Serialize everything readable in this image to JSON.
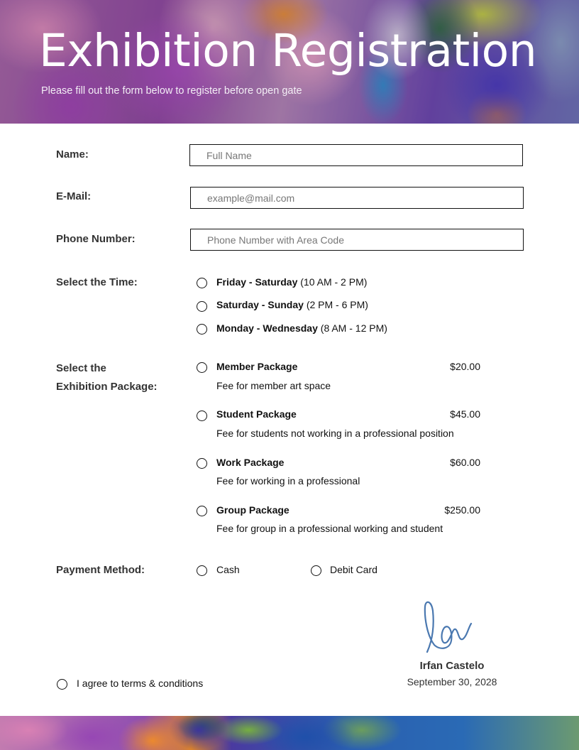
{
  "header": {
    "title": "Exhibition Registration",
    "subtitle": "Please fill out the form below to register before open gate"
  },
  "fields": {
    "name": {
      "label": "Name:",
      "placeholder": "Full Name",
      "value": ""
    },
    "email": {
      "label": "E-Mail:",
      "placeholder": "example@mail.com",
      "value": ""
    },
    "phone": {
      "label": "Phone Number:",
      "placeholder": "Phone Number with Area Code",
      "value": ""
    }
  },
  "time": {
    "label": "Select the Time:",
    "options": [
      {
        "days": "Friday - Saturday",
        "hours": "(10 AM - 2 PM)",
        "selected": false
      },
      {
        "days": "Saturday - Sunday",
        "hours": "(2 PM - 6 PM)",
        "selected": false
      },
      {
        "days": "Monday - Wednesday",
        "hours": "(8 AM - 12 PM)",
        "selected": false
      }
    ]
  },
  "package": {
    "label_line1": "Select the",
    "label_line2": "Exhibition Package:",
    "options": [
      {
        "name": "Member Package",
        "price": "$20.00",
        "description": "Fee for member art space",
        "selected": false
      },
      {
        "name": "Student Package",
        "price": "$45.00",
        "description": "Fee for students not working in a professional position",
        "selected": false
      },
      {
        "name": "Work Package",
        "price": "$60.00",
        "description": "Fee for working in a professional",
        "selected": false
      },
      {
        "name": "Group Package",
        "price": "$250.00",
        "description": "Fee for group in a professional working and student",
        "selected": false
      }
    ]
  },
  "payment": {
    "label": "Payment Method:",
    "options": [
      {
        "label": "Cash",
        "selected": false
      },
      {
        "label": "Debit Card",
        "selected": false
      }
    ]
  },
  "terms": {
    "label": "I agree to terms & conditions",
    "checked": false
  },
  "signature": {
    "name": "Irfan Castelo",
    "date": "September 30, 2028",
    "ink_color": "#4a78b0"
  }
}
